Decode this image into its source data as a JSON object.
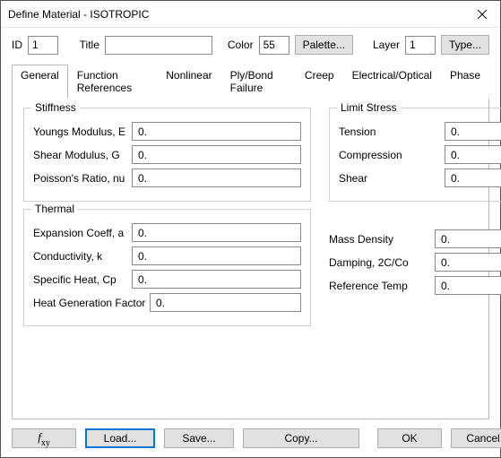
{
  "window": {
    "title": "Define Material - ISOTROPIC"
  },
  "top": {
    "idLabel": "ID",
    "idValue": "1",
    "titleLabel": "Title",
    "titleValue": "",
    "colorLabel": "Color",
    "colorValue": "55",
    "paletteBtn": "Palette...",
    "layerLabel": "Layer",
    "layerValue": "1",
    "typeBtn": "Type..."
  },
  "tabs": {
    "general": "General",
    "funcRef": "Function References",
    "nonlinear": "Nonlinear",
    "plyBond": "Ply/Bond Failure",
    "creep": "Creep",
    "electrical": "Electrical/Optical",
    "phase": "Phase"
  },
  "general": {
    "stiffnessTitle": "Stiffness",
    "youngsLabel": "Youngs Modulus, E",
    "youngsVal": "0.",
    "shearLabel": "Shear Modulus, G",
    "shearVal": "0.",
    "poissonLabel": "Poisson's Ratio, nu",
    "poissonVal": "0.",
    "thermalTitle": "Thermal",
    "expLabel": "Expansion Coeff, a",
    "expVal": "0.",
    "condLabel": "Conductivity, k",
    "condVal": "0.",
    "spHeatLabel": "Specific Heat, Cp",
    "spHeatVal": "0.",
    "heatGenLabel": "Heat Generation Factor",
    "heatGenVal": "0.",
    "limitTitle": "Limit Stress",
    "tensionLabel": "Tension",
    "tensionVal": "0.",
    "compLabel": "Compression",
    "compVal": "0.",
    "shearStressLabel": "Shear",
    "shearStressVal": "0.",
    "massLabel": "Mass Density",
    "massVal": "0.",
    "dampLabel": "Damping, 2C/Co",
    "dampVal": "0.",
    "refTempLabel": "Reference Temp",
    "refTempVal": "0."
  },
  "buttons": {
    "load": "Load...",
    "save": "Save...",
    "copy": "Copy...",
    "ok": "OK",
    "cancel": "Cancel"
  }
}
